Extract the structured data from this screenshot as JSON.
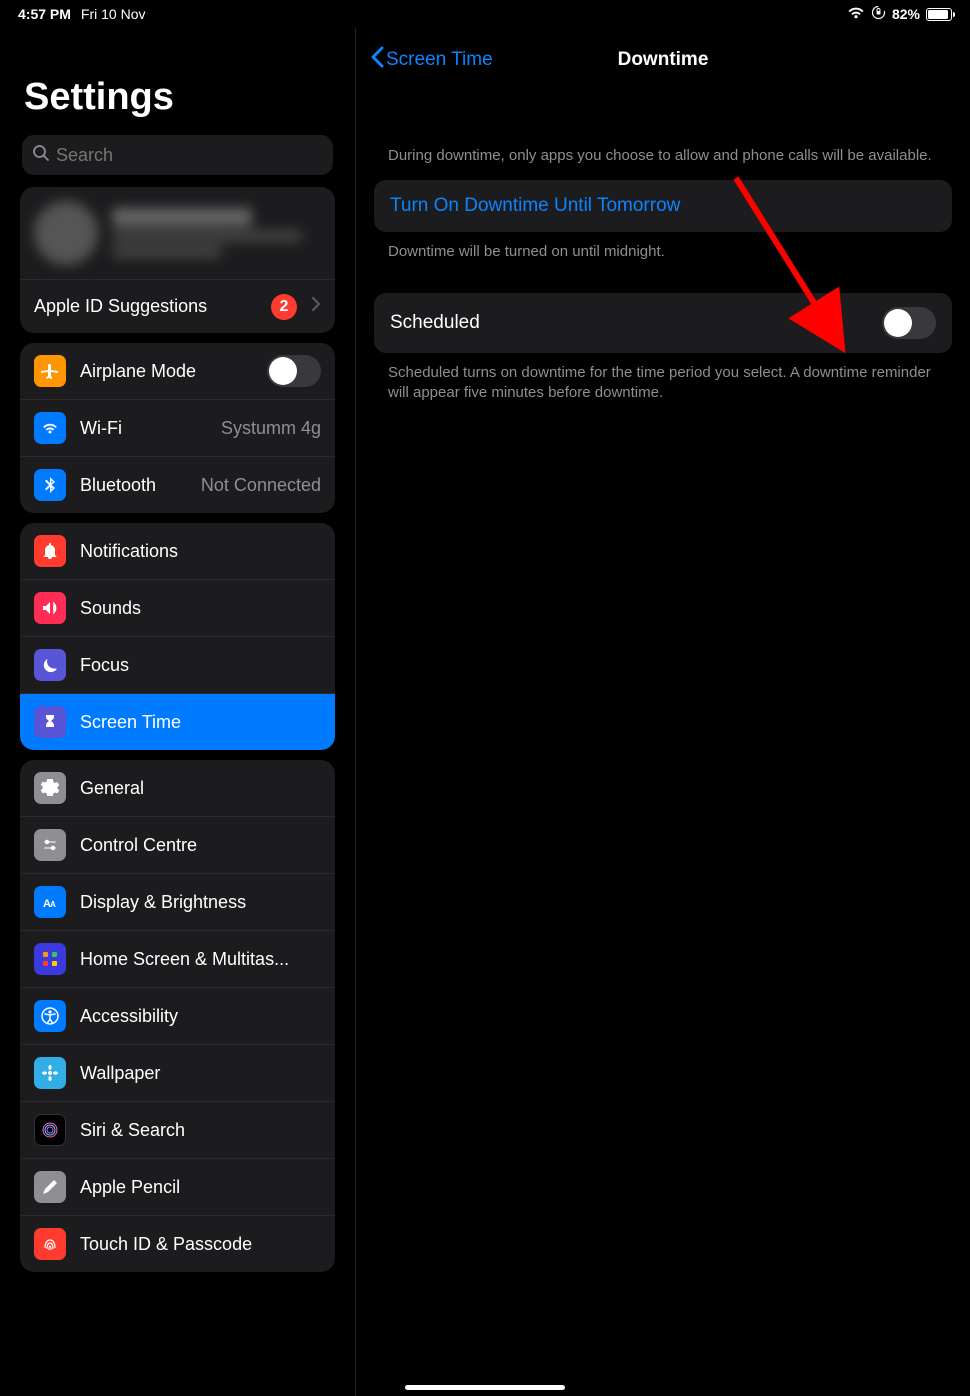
{
  "status": {
    "time": "4:57 PM",
    "date": "Fri 10 Nov",
    "battery_pct": "82%",
    "battery_fill_pct": 82
  },
  "sidebar": {
    "title_label": "Settings",
    "search_placeholder": "Search",
    "apple_id": {
      "suggestions_label": "Apple ID Suggestions",
      "suggestions_badge": "2"
    },
    "group_connectivity": {
      "airplane": {
        "label": "Airplane Mode"
      },
      "wifi": {
        "label": "Wi-Fi",
        "value": "Systumm 4g"
      },
      "bluetooth": {
        "label": "Bluetooth",
        "value": "Not Connected"
      }
    },
    "group_focus": {
      "notifications": {
        "label": "Notifications"
      },
      "sounds": {
        "label": "Sounds"
      },
      "focus": {
        "label": "Focus"
      },
      "screentime": {
        "label": "Screen Time"
      }
    },
    "group_general": {
      "general": {
        "label": "General"
      },
      "control_centre": {
        "label": "Control Centre"
      },
      "display": {
        "label": "Display & Brightness"
      },
      "home_screen": {
        "label": "Home Screen & Multitas..."
      },
      "accessibility": {
        "label": "Accessibility"
      },
      "wallpaper": {
        "label": "Wallpaper"
      },
      "siri": {
        "label": "Siri & Search"
      },
      "pencil": {
        "label": "Apple Pencil"
      },
      "touchid": {
        "label": "Touch ID & Passcode"
      }
    }
  },
  "detail": {
    "back_label": "Screen Time",
    "title_label": "Downtime",
    "intro_note": "During downtime, only apps you choose to allow and phone calls will be available.",
    "turn_on_label": "Turn On Downtime Until Tomorrow",
    "turn_on_note": "Downtime will be turned on until midnight.",
    "scheduled_label": "Scheduled",
    "scheduled_note": "Scheduled turns on downtime for the time period you select. A downtime reminder will appear five minutes before downtime."
  }
}
